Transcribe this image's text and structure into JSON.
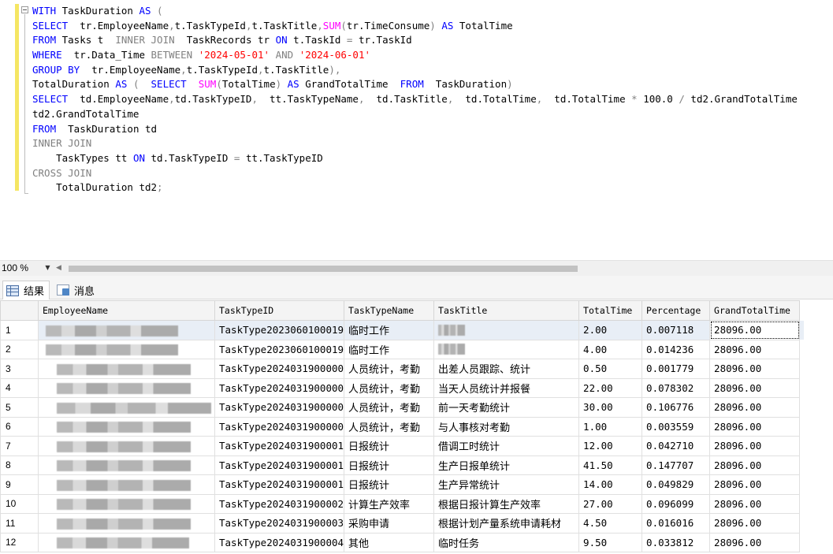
{
  "editor": {
    "lines": [
      [
        {
          "t": "WITH",
          "c": "kw"
        },
        {
          "t": " TaskDuration ",
          "c": "tx"
        },
        {
          "t": "AS",
          "c": "kw"
        },
        {
          "t": " (",
          "c": "gr"
        }
      ],
      [
        {
          "t": "SELECT",
          "c": "kw"
        },
        {
          "t": "  tr.EmployeeName",
          "c": "tx"
        },
        {
          "t": ",",
          "c": "gr"
        },
        {
          "t": "t.TaskTypeId",
          "c": "tx"
        },
        {
          "t": ",",
          "c": "gr"
        },
        {
          "t": "t.TaskTitle",
          "c": "tx"
        },
        {
          "t": ",",
          "c": "gr"
        },
        {
          "t": "SUM",
          "c": "fn"
        },
        {
          "t": "(",
          "c": "gr"
        },
        {
          "t": "tr.TimeConsume",
          "c": "tx"
        },
        {
          "t": ")",
          "c": "gr"
        },
        {
          "t": " AS",
          "c": "kw"
        },
        {
          "t": " TotalTime",
          "c": "tx"
        }
      ],
      [
        {
          "t": "FROM",
          "c": "kw"
        },
        {
          "t": " Tasks t  ",
          "c": "tx"
        },
        {
          "t": "INNER JOIN",
          "c": "gr"
        },
        {
          "t": "  TaskRecords tr ",
          "c": "tx"
        },
        {
          "t": "ON",
          "c": "kw"
        },
        {
          "t": " t.TaskId ",
          "c": "tx"
        },
        {
          "t": "=",
          "c": "gr"
        },
        {
          "t": " tr.TaskId",
          "c": "tx"
        }
      ],
      [
        {
          "t": "WHERE",
          "c": "kw"
        },
        {
          "t": "  tr.Data_Time ",
          "c": "tx"
        },
        {
          "t": "BETWEEN",
          "c": "gr"
        },
        {
          "t": " '2024-05-01'",
          "c": "st"
        },
        {
          "t": " AND",
          "c": "gr"
        },
        {
          "t": " '2024-06-01'",
          "c": "st"
        }
      ],
      [
        {
          "t": "GROUP BY",
          "c": "kw"
        },
        {
          "t": "  tr.EmployeeName",
          "c": "tx"
        },
        {
          "t": ",",
          "c": "gr"
        },
        {
          "t": "t.TaskTypeId",
          "c": "tx"
        },
        {
          "t": ",",
          "c": "gr"
        },
        {
          "t": "t.TaskTitle",
          "c": "tx"
        },
        {
          "t": "),",
          "c": "gr"
        }
      ],
      [
        {
          "t": "TotalDuration ",
          "c": "tx"
        },
        {
          "t": "AS",
          "c": "kw"
        },
        {
          "t": " (  ",
          "c": "gr"
        },
        {
          "t": "SELECT",
          "c": "kw"
        },
        {
          "t": "  ",
          "c": "tx"
        },
        {
          "t": "SUM",
          "c": "fn"
        },
        {
          "t": "(",
          "c": "gr"
        },
        {
          "t": "TotalTime",
          "c": "tx"
        },
        {
          "t": ")",
          "c": "gr"
        },
        {
          "t": " AS",
          "c": "kw"
        },
        {
          "t": " GrandTotalTime  ",
          "c": "tx"
        },
        {
          "t": "FROM",
          "c": "kw"
        },
        {
          "t": "  TaskDuration",
          "c": "tx"
        },
        {
          "t": ")",
          "c": "gr"
        }
      ],
      [
        {
          "t": "SELECT",
          "c": "kw"
        },
        {
          "t": "  td.EmployeeName",
          "c": "tx"
        },
        {
          "t": ",",
          "c": "gr"
        },
        {
          "t": "td.TaskTypeID",
          "c": "tx"
        },
        {
          "t": ",",
          "c": "gr"
        },
        {
          "t": "  tt.TaskTypeName",
          "c": "tx"
        },
        {
          "t": ",",
          "c": "gr"
        },
        {
          "t": "  td.TaskTitle",
          "c": "tx"
        },
        {
          "t": ",",
          "c": "gr"
        },
        {
          "t": "  td.TotalTime",
          "c": "tx"
        },
        {
          "t": ",",
          "c": "gr"
        },
        {
          "t": "  td.TotalTime ",
          "c": "tx"
        },
        {
          "t": "*",
          "c": "gr"
        },
        {
          "t": " 100.0 ",
          "c": "tx"
        },
        {
          "t": "/",
          "c": "gr"
        },
        {
          "t": " td2.GrandTotalTime",
          "c": "tx"
        }
      ],
      [
        {
          "t": "td2.GrandTotalTime",
          "c": "tx"
        }
      ],
      [
        {
          "t": "FROM",
          "c": "kw"
        },
        {
          "t": "  TaskDuration td",
          "c": "tx"
        }
      ],
      [
        {
          "t": "INNER JOIN",
          "c": "gr"
        }
      ],
      [
        {
          "t": "    TaskTypes tt ",
          "c": "tx"
        },
        {
          "t": "ON",
          "c": "kw"
        },
        {
          "t": " td.TaskTypeID ",
          "c": "tx"
        },
        {
          "t": "=",
          "c": "gr"
        },
        {
          "t": " tt.TaskTypeID",
          "c": "tx"
        }
      ],
      [
        {
          "t": "CROSS JOIN",
          "c": "gr"
        }
      ],
      [
        {
          "t": "    TotalDuration td2",
          "c": "tx"
        },
        {
          "t": ";",
          "c": "gr"
        }
      ]
    ]
  },
  "statusbar": {
    "zoom": "100 %"
  },
  "tabs": {
    "results": "结果",
    "messages": "消息"
  },
  "grid": {
    "columns": [
      "EmployeeName",
      "TaskTypeID",
      "TaskTypeName",
      "TaskTitle",
      "TotalTime",
      "Percentage",
      "GrandTotalTime"
    ],
    "rows": [
      {
        "n": "1",
        "emp_redacted": true,
        "type_id": "TaskType2023060100019",
        "type_name": "临时工作",
        "title": "",
        "title_redacted": true,
        "total": "2.00",
        "pct": "0.007118",
        "grand": "28096.00"
      },
      {
        "n": "2",
        "emp_redacted": true,
        "type_id": "TaskType2023060100019",
        "type_name": "临时工作",
        "title": "",
        "title_redacted": true,
        "total": "4.00",
        "pct": "0.014236",
        "grand": "28096.00"
      },
      {
        "n": "3",
        "emp_redacted": true,
        "type_id": "TaskType2024031900000",
        "type_name": "人员统计，考勤",
        "title": "出差人员跟踪、统计",
        "title_redacted": false,
        "total": "0.50",
        "pct": "0.001779",
        "grand": "28096.00"
      },
      {
        "n": "4",
        "emp_redacted": true,
        "type_id": "TaskType2024031900000",
        "type_name": "人员统计，考勤",
        "title": "当天人员统计并报餐",
        "title_redacted": false,
        "total": "22.00",
        "pct": "0.078302",
        "grand": "28096.00"
      },
      {
        "n": "5",
        "emp_redacted": true,
        "type_id": "TaskType2024031900000",
        "type_name": "人员统计，考勤",
        "title": "前一天考勤统计",
        "title_redacted": false,
        "total": "30.00",
        "pct": "0.106776",
        "grand": "28096.00"
      },
      {
        "n": "6",
        "emp_redacted": true,
        "type_id": "TaskType2024031900000",
        "type_name": "人员统计，考勤",
        "title": "与人事核对考勤",
        "title_redacted": false,
        "total": "1.00",
        "pct": "0.003559",
        "grand": "28096.00"
      },
      {
        "n": "7",
        "emp_redacted": true,
        "type_id": "TaskType2024031900001",
        "type_name": "日报统计",
        "title": "借调工时统计",
        "title_redacted": false,
        "total": "12.00",
        "pct": "0.042710",
        "grand": "28096.00"
      },
      {
        "n": "8",
        "emp_redacted": true,
        "type_id": "TaskType2024031900001",
        "type_name": "日报统计",
        "title": "生产日报单统计",
        "title_redacted": false,
        "total": "41.50",
        "pct": "0.147707",
        "grand": "28096.00"
      },
      {
        "n": "9",
        "emp_redacted": true,
        "type_id": "TaskType2024031900001",
        "type_name": "日报统计",
        "title": "生产异常统计",
        "title_redacted": false,
        "total": "14.00",
        "pct": "0.049829",
        "grand": "28096.00"
      },
      {
        "n": "10",
        "emp_redacted": true,
        "type_id": "TaskType2024031900002",
        "type_name": "计算生产效率",
        "title": "根据日报计算生产效率",
        "title_redacted": false,
        "total": "27.00",
        "pct": "0.096099",
        "grand": "28096.00"
      },
      {
        "n": "11",
        "emp_redacted": true,
        "type_id": "TaskType2024031900003",
        "type_name": "采购申请",
        "title": "根据计划产量系统申请耗材",
        "title_redacted": false,
        "total": "4.50",
        "pct": "0.016016",
        "grand": "28096.00"
      },
      {
        "n": "12",
        "emp_redacted": true,
        "type_id": "TaskType2024031900004",
        "type_name": "其他",
        "title": "临时任务",
        "title_redacted": false,
        "total": "9.50",
        "pct": "0.033812",
        "grand": "28096.00"
      }
    ]
  },
  "colors": {
    "keyword": "#0000ff",
    "function": "#ff00ff",
    "string": "#ff0000",
    "operator": "#808080",
    "change_bar": "#f5e663"
  }
}
